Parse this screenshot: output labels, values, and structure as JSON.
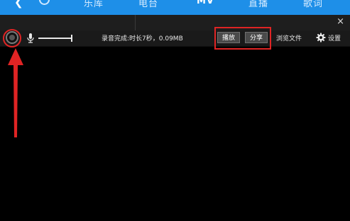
{
  "nav": {
    "items": [
      "乐库",
      "电台",
      "MV",
      "直播",
      "歌词"
    ],
    "active_index": 2
  },
  "window": {
    "close_glyph": "×"
  },
  "recorder": {
    "status": "录音完成:时长7秒，0.09MB",
    "play_label": "播放",
    "share_label": "分享",
    "browse_label": "浏览文件",
    "settings_label": "设置",
    "volume_level": 1.0
  },
  "annotations": {
    "color": "#e02424"
  },
  "colors": {
    "nav_bg": "#1e8fe8",
    "toolbar_bg": "#1a1a1a",
    "content_bg": "#000000"
  },
  "icons": [
    "back-icon",
    "refresh-icon",
    "close-icon",
    "record-icon",
    "microphone-icon",
    "gear-icon"
  ]
}
